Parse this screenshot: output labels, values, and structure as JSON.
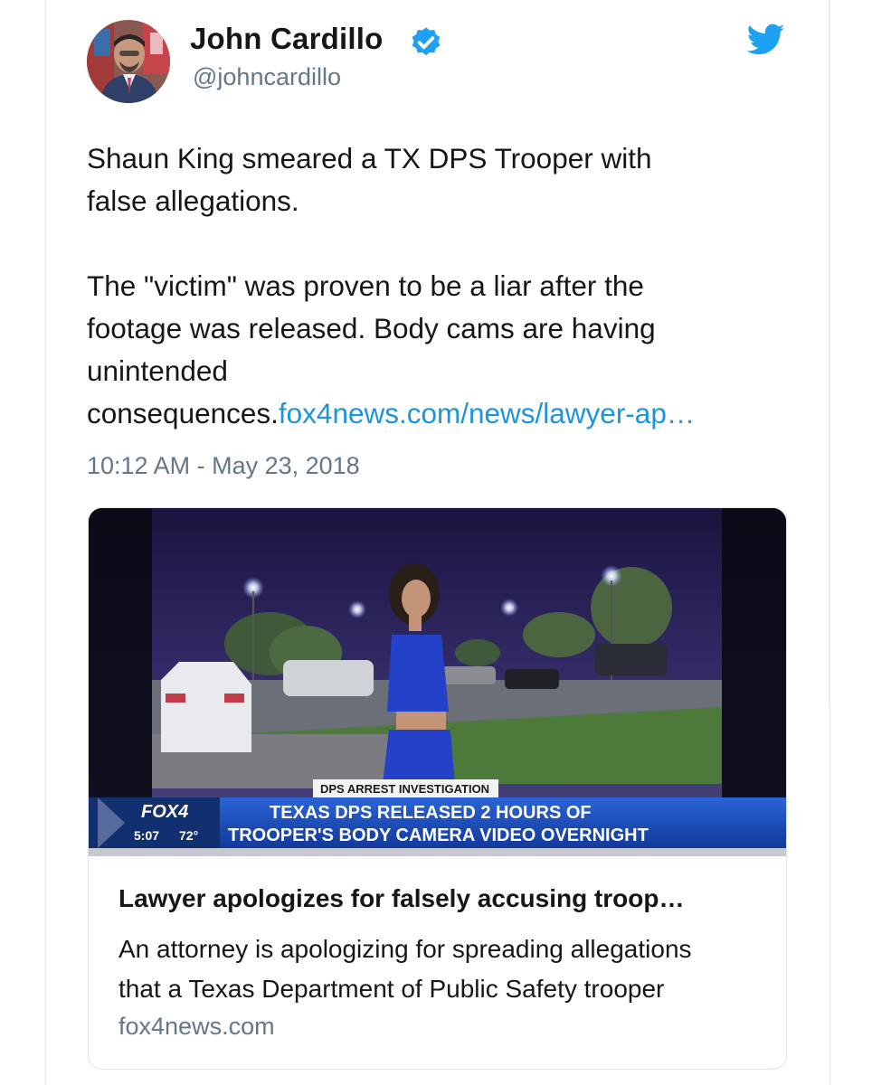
{
  "author": {
    "name": "John Cardillo",
    "handle": "@johncardillo"
  },
  "tweet": {
    "line1": "Shaun King smeared a TX DPS Trooper with",
    "line2": "false allegations.",
    "line3": "The \"victim\" was proven to be a liar after the",
    "line4": "footage was released. Body cams are having",
    "line5": "unintended",
    "line6_text": "consequences.",
    "line6_link": "fox4news.com/news/lawyer-ap…",
    "timestamp": "10:12 AM - May 23, 2018"
  },
  "card": {
    "image": {
      "banner_top": "DPS ARREST INVESTIGATION",
      "channel": "FOX4",
      "time": "5:07",
      "temperature": "72°",
      "headline_1": "TEXAS DPS RELEASED 2 HOURS OF",
      "headline_2": "TROOPER'S BODY CAMERA VIDEO OVERNIGHT"
    },
    "title": "Lawyer apologizes for falsely accusing troop…",
    "description_1": "An attorney is apologizing for spreading allegations",
    "description_2": "that a Texas Department of Public Safety trooper",
    "domain": "fox4news.com"
  },
  "colors": {
    "link": "#1b95e0",
    "verified": "#1da1f2",
    "text": "#14171a",
    "muted": "#657786",
    "chyron_blue": "#1d4fb8"
  },
  "icons": {
    "verified": "verified-badge-icon",
    "brand": "twitter-bird-icon"
  }
}
